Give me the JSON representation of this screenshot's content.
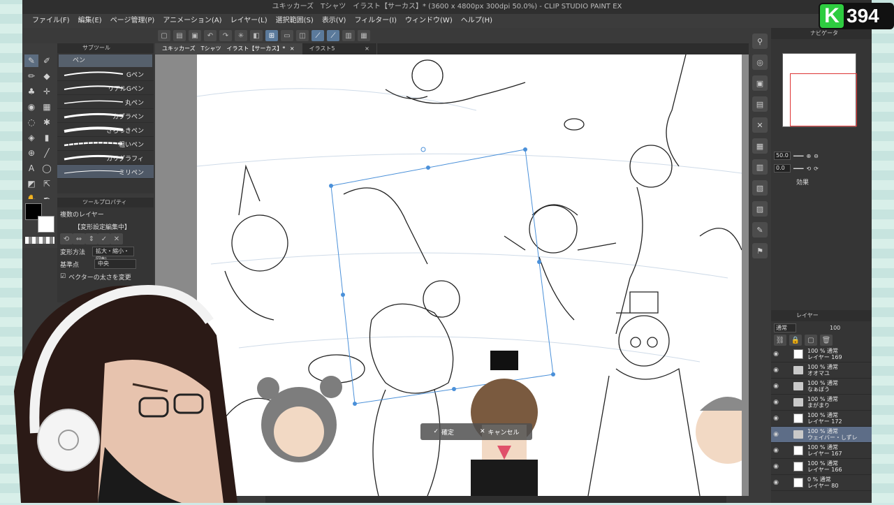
{
  "window": {
    "title": "ユキッカーズ　Tシャツ　イラスト【サーカス】* (3600 x 4800px 300dpi 50.0%) - CLIP STUDIO PAINT EX"
  },
  "menu": [
    "ファイル(F)",
    "編集(E)",
    "ページ管理(P)",
    "アニメーション(A)",
    "レイヤー(L)",
    "選択範囲(S)",
    "表示(V)",
    "フィルター(I)",
    "ウィンドウ(W)",
    "ヘルプ(H)"
  ],
  "canvas_tabs": [
    {
      "label": "ユキッカーズ　Tシャツ　イラスト【サーカス】*",
      "close": "×"
    },
    {
      "label": "イラスト5",
      "close": "×"
    }
  ],
  "subtool_panel": {
    "title": "サブツール",
    "group": "ペン",
    "brushes": [
      "Gペン",
      "リアルGペン",
      "丸ペン",
      "カブラペン",
      "さらっきペン",
      "粗いペン",
      "カリグラフィ",
      "ミリペン"
    ]
  },
  "tool_property": {
    "title": "ツールプロパティ",
    "target": "複数のレイヤー",
    "mode": "【変形設定編集中】",
    "transform_label": "変形方法",
    "transform_value": "拡大・縮小・回転",
    "pivot_label": "基準点",
    "pivot_value": "中央",
    "vector_label": "ベクターの太さを変更"
  },
  "navigator": {
    "title": "ナビゲータ",
    "zoom": "50.0",
    "rotate": "0.0"
  },
  "effect_panel": {
    "title": "効果"
  },
  "layers_panel": {
    "title": "レイヤー",
    "blend_mode": "通常",
    "opacity": "100",
    "layers": [
      {
        "pct": "100 % 通常",
        "name": "レイヤー 169",
        "type": "layer",
        "selected": false
      },
      {
        "pct": "100 % 通常",
        "name": "オオマユ",
        "type": "folder",
        "selected": false
      },
      {
        "pct": "100 % 通常",
        "name": "なぁぼう",
        "type": "folder",
        "selected": false
      },
      {
        "pct": "100 % 通常",
        "name": "まがまり",
        "type": "folder",
        "selected": false
      },
      {
        "pct": "100 % 通常",
        "name": "レイヤー 172",
        "type": "layer",
        "selected": false
      },
      {
        "pct": "100 % 通常",
        "name": "ウェイバー・しずレ",
        "type": "folder",
        "selected": true
      },
      {
        "pct": "100 % 通常",
        "name": "レイヤー 167",
        "type": "layer",
        "selected": false
      },
      {
        "pct": "100 % 通常",
        "name": "レイヤー 166",
        "type": "layer",
        "selected": false
      },
      {
        "pct": "0 % 通常",
        "name": "レイヤー 80",
        "type": "layer",
        "selected": false
      }
    ]
  },
  "transform_confirm": {
    "ok_label": "確定",
    "cancel_label": "キャンセル"
  },
  "badge": {
    "letter": "K",
    "number": "394",
    "color": "#2ecc40"
  },
  "colors": {
    "foreground": "#000000",
    "background": "#ffffff",
    "accent": "#5b7a9b"
  }
}
